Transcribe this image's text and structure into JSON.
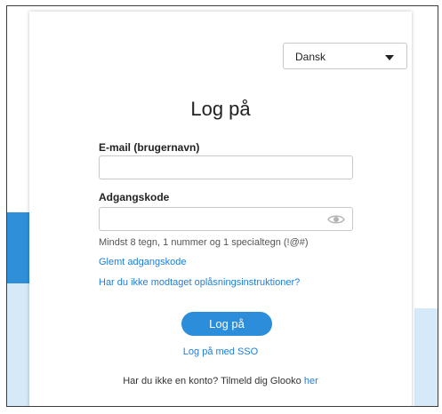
{
  "language": {
    "selected": "Dansk"
  },
  "login": {
    "title": "Log på",
    "email_label": "E-mail (brugernavn)",
    "email_value": "",
    "password_label": "Adgangskode",
    "password_value": "",
    "password_hint": "Mindst 8 tegn, 1 nummer og 1 specialtegn (!@#)",
    "forgot_password_link": "Glemt adgangskode",
    "unlock_link": "Har du ikke modtaget oplåsningsinstruktioner?",
    "submit_label": "Log på",
    "sso_link": "Log på med SSO",
    "signup_text": "Har du ikke en konto? Tilmeld dig Glooko ",
    "signup_link": "her"
  },
  "colors": {
    "accent": "#2c8ddb",
    "link": "#1f7ed8",
    "background_blue": "#2f8fd9",
    "background_light_blue": "#d5e9f8"
  },
  "icons": {
    "password_toggle": "eye-icon",
    "dropdown": "chevron-down-icon"
  }
}
